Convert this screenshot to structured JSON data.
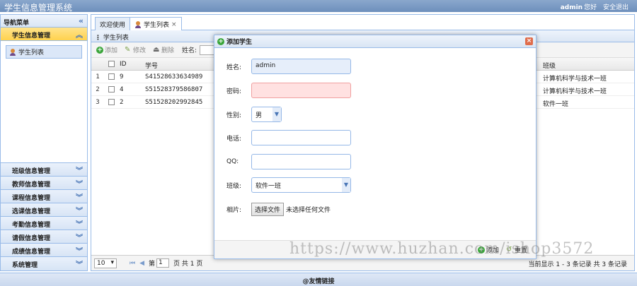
{
  "app": {
    "title": "学生信息管理系统",
    "username": "admin",
    "greeting": "您好",
    "logout": "安全退出"
  },
  "sidebar": {
    "title": "导航菜单",
    "active_section": {
      "label": "学生信息管理",
      "items": [
        {
          "label": "学生列表"
        }
      ]
    },
    "sections": [
      {
        "label": "班级信息管理"
      },
      {
        "label": "教师信息管理"
      },
      {
        "label": "课程信息管理"
      },
      {
        "label": "选课信息管理"
      },
      {
        "label": "考勤信息管理"
      },
      {
        "label": "请假信息管理"
      },
      {
        "label": "成绩信息管理"
      },
      {
        "label": "系统管理"
      }
    ]
  },
  "tabs": [
    {
      "label": "欢迎使用"
    },
    {
      "label": "学生列表",
      "close": "×"
    }
  ],
  "panel": {
    "title": "学生列表"
  },
  "toolbar": {
    "add": "添加",
    "edit": "修改",
    "delete": "删除",
    "name_label": "姓名:"
  },
  "grid": {
    "headers": {
      "id": "ID",
      "sn": "学号",
      "class": "班级"
    },
    "rows": [
      {
        "num": "1",
        "id": "9",
        "sn": "S41528633634989",
        "class": "计算机科学与技术一班"
      },
      {
        "num": "2",
        "id": "4",
        "sn": "S51528379586807",
        "class": "计算机科学与技术一班"
      },
      {
        "num": "3",
        "id": "2",
        "sn": "S51528202992845",
        "class": "软件一班"
      }
    ]
  },
  "pager": {
    "page_size": "10",
    "page_prefix": "第",
    "page_value": "1",
    "page_suffix": "页 共 1 页",
    "info": "当前显示 1 - 3 条记录 共 3 条记录"
  },
  "footer": {
    "text": "@友情链接"
  },
  "dialog": {
    "title": "添加学生",
    "close": "×",
    "fields": {
      "name": {
        "label": "姓名:",
        "value": "admin"
      },
      "password": {
        "label": "密码:",
        "value": ""
      },
      "gender": {
        "label": "性别:",
        "value": "男"
      },
      "phone": {
        "label": "电话:",
        "value": ""
      },
      "qq": {
        "label": "QQ:",
        "value": ""
      },
      "class": {
        "label": "班级:",
        "value": "软件一班"
      },
      "photo": {
        "label": "相片:",
        "button": "选择文件",
        "status": "未选择任何文件"
      }
    },
    "footer": {
      "add": "添加",
      "reset": "重置"
    }
  },
  "watermark": "https://www.huzhan.com/ishop3572",
  "colors": {
    "accent": "#99bbe8",
    "active_section": "#ffd24d",
    "error_field": "#ffe1e1"
  }
}
